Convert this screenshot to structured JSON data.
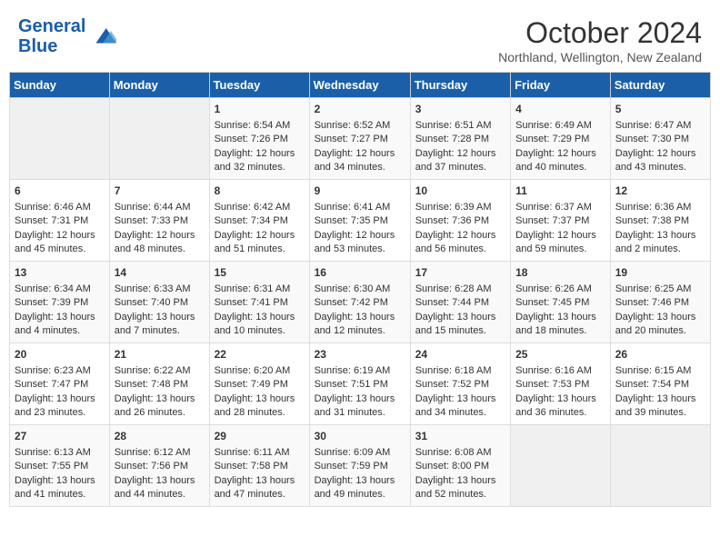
{
  "header": {
    "logo_text_general": "General",
    "logo_text_blue": "Blue",
    "month_title": "October 2024",
    "location": "Northland, Wellington, New Zealand"
  },
  "days_of_week": [
    "Sunday",
    "Monday",
    "Tuesday",
    "Wednesday",
    "Thursday",
    "Friday",
    "Saturday"
  ],
  "weeks": [
    [
      {
        "day": "",
        "info": ""
      },
      {
        "day": "",
        "info": ""
      },
      {
        "day": "1",
        "info": "Sunrise: 6:54 AM\nSunset: 7:26 PM\nDaylight: 12 hours and 32 minutes."
      },
      {
        "day": "2",
        "info": "Sunrise: 6:52 AM\nSunset: 7:27 PM\nDaylight: 12 hours and 34 minutes."
      },
      {
        "day": "3",
        "info": "Sunrise: 6:51 AM\nSunset: 7:28 PM\nDaylight: 12 hours and 37 minutes."
      },
      {
        "day": "4",
        "info": "Sunrise: 6:49 AM\nSunset: 7:29 PM\nDaylight: 12 hours and 40 minutes."
      },
      {
        "day": "5",
        "info": "Sunrise: 6:47 AM\nSunset: 7:30 PM\nDaylight: 12 hours and 43 minutes."
      }
    ],
    [
      {
        "day": "6",
        "info": "Sunrise: 6:46 AM\nSunset: 7:31 PM\nDaylight: 12 hours and 45 minutes."
      },
      {
        "day": "7",
        "info": "Sunrise: 6:44 AM\nSunset: 7:33 PM\nDaylight: 12 hours and 48 minutes."
      },
      {
        "day": "8",
        "info": "Sunrise: 6:42 AM\nSunset: 7:34 PM\nDaylight: 12 hours and 51 minutes."
      },
      {
        "day": "9",
        "info": "Sunrise: 6:41 AM\nSunset: 7:35 PM\nDaylight: 12 hours and 53 minutes."
      },
      {
        "day": "10",
        "info": "Sunrise: 6:39 AM\nSunset: 7:36 PM\nDaylight: 12 hours and 56 minutes."
      },
      {
        "day": "11",
        "info": "Sunrise: 6:37 AM\nSunset: 7:37 PM\nDaylight: 12 hours and 59 minutes."
      },
      {
        "day": "12",
        "info": "Sunrise: 6:36 AM\nSunset: 7:38 PM\nDaylight: 13 hours and 2 minutes."
      }
    ],
    [
      {
        "day": "13",
        "info": "Sunrise: 6:34 AM\nSunset: 7:39 PM\nDaylight: 13 hours and 4 minutes."
      },
      {
        "day": "14",
        "info": "Sunrise: 6:33 AM\nSunset: 7:40 PM\nDaylight: 13 hours and 7 minutes."
      },
      {
        "day": "15",
        "info": "Sunrise: 6:31 AM\nSunset: 7:41 PM\nDaylight: 13 hours and 10 minutes."
      },
      {
        "day": "16",
        "info": "Sunrise: 6:30 AM\nSunset: 7:42 PM\nDaylight: 13 hours and 12 minutes."
      },
      {
        "day": "17",
        "info": "Sunrise: 6:28 AM\nSunset: 7:44 PM\nDaylight: 13 hours and 15 minutes."
      },
      {
        "day": "18",
        "info": "Sunrise: 6:26 AM\nSunset: 7:45 PM\nDaylight: 13 hours and 18 minutes."
      },
      {
        "day": "19",
        "info": "Sunrise: 6:25 AM\nSunset: 7:46 PM\nDaylight: 13 hours and 20 minutes."
      }
    ],
    [
      {
        "day": "20",
        "info": "Sunrise: 6:23 AM\nSunset: 7:47 PM\nDaylight: 13 hours and 23 minutes."
      },
      {
        "day": "21",
        "info": "Sunrise: 6:22 AM\nSunset: 7:48 PM\nDaylight: 13 hours and 26 minutes."
      },
      {
        "day": "22",
        "info": "Sunrise: 6:20 AM\nSunset: 7:49 PM\nDaylight: 13 hours and 28 minutes."
      },
      {
        "day": "23",
        "info": "Sunrise: 6:19 AM\nSunset: 7:51 PM\nDaylight: 13 hours and 31 minutes."
      },
      {
        "day": "24",
        "info": "Sunrise: 6:18 AM\nSunset: 7:52 PM\nDaylight: 13 hours and 34 minutes."
      },
      {
        "day": "25",
        "info": "Sunrise: 6:16 AM\nSunset: 7:53 PM\nDaylight: 13 hours and 36 minutes."
      },
      {
        "day": "26",
        "info": "Sunrise: 6:15 AM\nSunset: 7:54 PM\nDaylight: 13 hours and 39 minutes."
      }
    ],
    [
      {
        "day": "27",
        "info": "Sunrise: 6:13 AM\nSunset: 7:55 PM\nDaylight: 13 hours and 41 minutes."
      },
      {
        "day": "28",
        "info": "Sunrise: 6:12 AM\nSunset: 7:56 PM\nDaylight: 13 hours and 44 minutes."
      },
      {
        "day": "29",
        "info": "Sunrise: 6:11 AM\nSunset: 7:58 PM\nDaylight: 13 hours and 47 minutes."
      },
      {
        "day": "30",
        "info": "Sunrise: 6:09 AM\nSunset: 7:59 PM\nDaylight: 13 hours and 49 minutes."
      },
      {
        "day": "31",
        "info": "Sunrise: 6:08 AM\nSunset: 8:00 PM\nDaylight: 13 hours and 52 minutes."
      },
      {
        "day": "",
        "info": ""
      },
      {
        "day": "",
        "info": ""
      }
    ]
  ]
}
